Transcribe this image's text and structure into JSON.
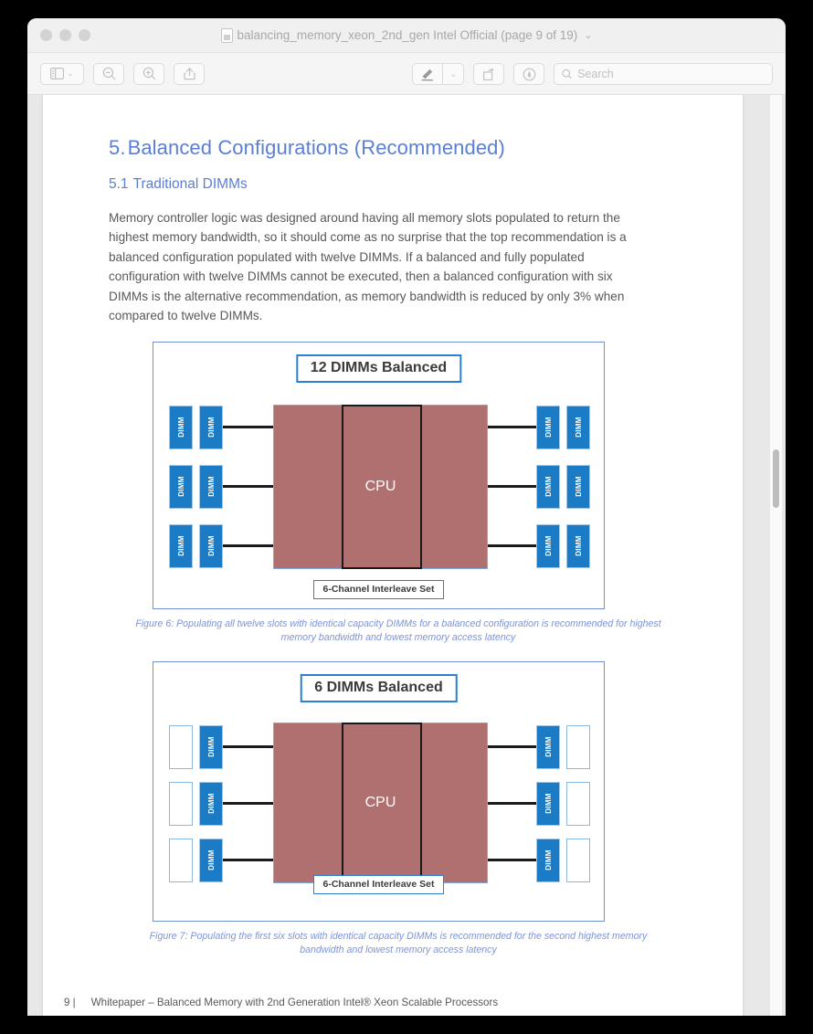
{
  "window": {
    "title": "balancing_memory_xeon_2nd_gen Intel Official (page 9 of 19)",
    "title_chevron": "⌄",
    "traffic_lights": [
      "close",
      "minimize",
      "zoom"
    ]
  },
  "toolbar": {
    "sidebar_toggle": "sidebar-toggle",
    "sidebar_chevron": "⌄",
    "zoom_out": "zoom-out",
    "zoom_in": "zoom-in",
    "share": "share",
    "markup": "markup",
    "markup_chevron": "⌄",
    "rotate": "rotate",
    "annotate": "annotate",
    "search_placeholder": "Search",
    "search_value": ""
  },
  "document": {
    "section_number": "5.",
    "section_title": "Balanced Configurations (Recommended)",
    "subsection_number": "5.1",
    "subsection_title": "Traditional DIMMs",
    "paragraph": "Memory controller logic was designed around having all memory slots populated to return the highest memory bandwidth, so it should come as no surprise that the top recommendation is a balanced configuration populated with twelve DIMMs. If a balanced and fully populated configuration with twelve DIMMs cannot be executed, then a balanced configuration with six DIMMs is the alternative recommendation, as memory bandwidth is reduced by only 3% when compared to twelve DIMMs.",
    "figures": [
      {
        "badge": "12 DIMMs Balanced",
        "cpu_label": "CPU",
        "interleave_label": "6-Channel Interleave Set",
        "dimm_label": "DIMM",
        "caption": "Figure 6: Populating all twelve slots with identical capacity DIMMs for a balanced configuration is recommended for highest memory bandwidth and lowest memory access latency",
        "slots": {
          "left_outer": [
            "filled",
            "filled",
            "filled"
          ],
          "left_inner": [
            "filled",
            "filled",
            "filled"
          ],
          "right_inner": [
            "filled",
            "filled",
            "filled"
          ],
          "right_outer": [
            "filled",
            "filled",
            "filled"
          ]
        }
      },
      {
        "badge": "6 DIMMs Balanced",
        "cpu_label": "CPU",
        "interleave_label": "6-Channel Interleave Set",
        "dimm_label": "DIMM",
        "caption": "Figure 7: Populating the first six slots with identical capacity DIMMs is recommended for the second highest memory bandwidth and lowest memory access latency",
        "slots": {
          "left_outer": [
            "empty",
            "empty",
            "empty"
          ],
          "left_inner": [
            "filled",
            "filled",
            "filled"
          ],
          "right_inner": [
            "filled",
            "filled",
            "filled"
          ],
          "right_outer": [
            "empty",
            "empty",
            "empty"
          ]
        }
      }
    ],
    "footer": {
      "page_number": "9 |",
      "text": "Whitepaper – Balanced Memory with 2nd Generation Intel® Xeon Scalable Processors"
    }
  },
  "colors": {
    "heading_blue": "#5b7fd4",
    "dimm_blue": "#1b7bc4",
    "dimm_border": "#9fc6e8",
    "empty_border": "#8cb8e0",
    "cpu_rose": "#b0706f",
    "figure_border": "#6f8fd6",
    "badge_border": "#2a7fd4",
    "caption_blue": "#7d94d9",
    "body_text": "#58585a"
  }
}
